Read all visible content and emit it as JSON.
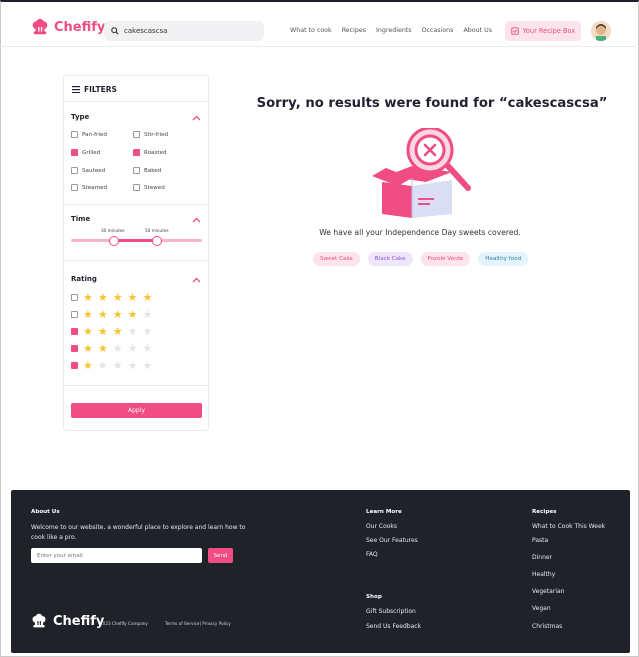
{
  "header": {
    "brand": "Chefify",
    "search_value": "cakescascsa",
    "nav": [
      "What to cook",
      "Recipes",
      "Ingredients",
      "Occasions",
      "About Us"
    ],
    "recipe_box_label": "Your Recipe Box"
  },
  "filters": {
    "title": "FILTERS",
    "type": {
      "title": "Type",
      "options": [
        {
          "label": "Pan-fried",
          "checked": false
        },
        {
          "label": "Stir-fried",
          "checked": false
        },
        {
          "label": "Grilled",
          "checked": true
        },
        {
          "label": "Roasted",
          "checked": true
        },
        {
          "label": "Sauteed",
          "checked": false
        },
        {
          "label": "Baked",
          "checked": false
        },
        {
          "label": "Steamed",
          "checked": false
        },
        {
          "label": "Stewed",
          "checked": false
        }
      ]
    },
    "time": {
      "title": "Time",
      "min_label": "30 minutes",
      "max_label": "50 minutes"
    },
    "rating": {
      "title": "Rating",
      "rows": [
        {
          "stars": 5,
          "checked": false
        },
        {
          "stars": 4,
          "checked": false
        },
        {
          "stars": 3,
          "checked": true
        },
        {
          "stars": 2,
          "checked": true
        },
        {
          "stars": 1,
          "checked": true
        }
      ]
    },
    "apply_label": "Apply"
  },
  "main": {
    "no_results": "Sorry, no results were found for “cakescascsa”",
    "subtext": "We have all your Independence Day sweets covered.",
    "tags": [
      {
        "label": "Sweet Cake",
        "bg": "#fde3ec",
        "fg": "#ef4d83"
      },
      {
        "label": "Black Cake",
        "bg": "#efe6fb",
        "fg": "#8a53d6"
      },
      {
        "label": "Pozole Verde",
        "bg": "#fde3ec",
        "fg": "#ef4d83"
      },
      {
        "label": "Healthy food",
        "bg": "#e3f4fb",
        "fg": "#2f7fa8"
      }
    ]
  },
  "footer": {
    "about_title": "About Us",
    "about_text_1": "Welcome to our website, a wonderful place to explore and learn how to",
    "about_text_2": "cook like a pro.",
    "email_placeholder": "Enter your email",
    "send_label": "Send",
    "brand": "Chefify",
    "copyright": "2023 Chefify Company",
    "terms": "Terms of Service| Privacy Policy",
    "learn_title": "Learn More",
    "learn_items": [
      "Our Cooks",
      "See Our Features",
      "FAQ"
    ],
    "shop_title": "Shop",
    "shop_items": [
      "Gift Subscription",
      "Send Us Feedback"
    ],
    "recipes_title": "Recipes",
    "recipes_items": [
      "What to Cook This Week",
      "Pasta",
      "Dinner",
      "Healthy",
      "Vegetarian",
      "Vegan",
      "Christmas"
    ]
  },
  "colors": {
    "accent": "#ef4d83",
    "footer_bg": "#1f2229",
    "star_filled": "#f3c531"
  }
}
